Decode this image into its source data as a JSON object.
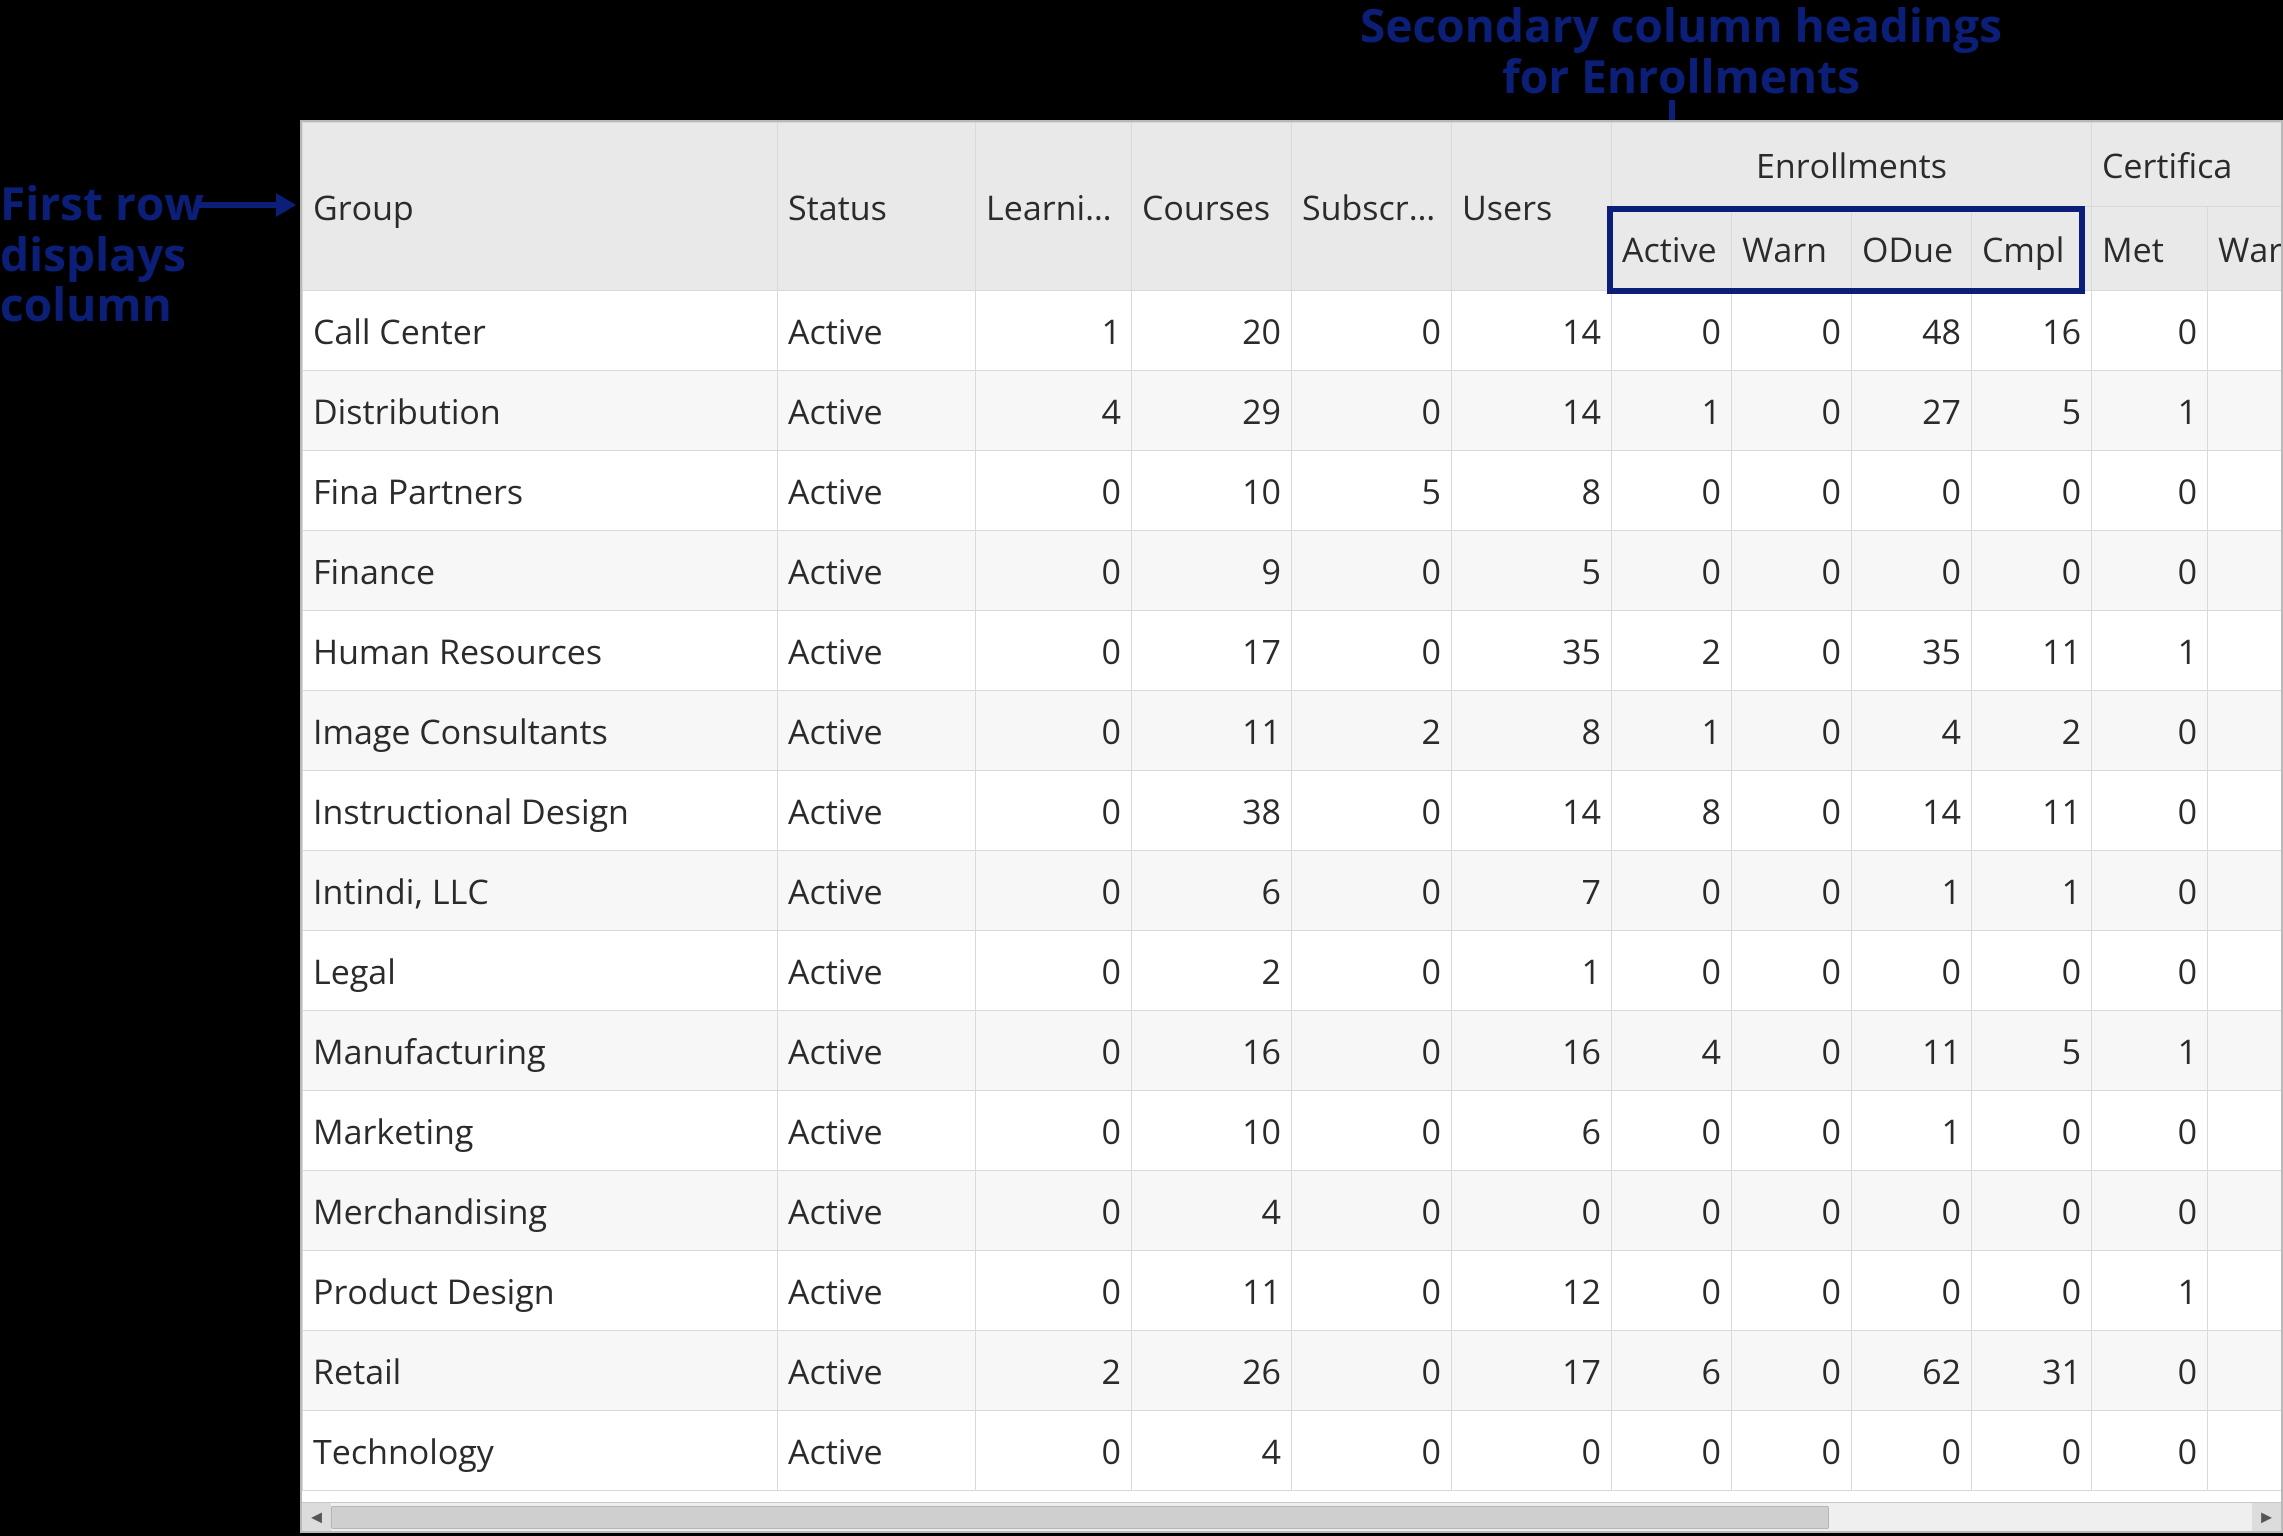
{
  "annotations": {
    "first_row": "First row\ndisplays\ncolumn",
    "secondary": "Secondary column headings\nfor Enrollments"
  },
  "headers": {
    "group": "Group",
    "status": "Status",
    "learning": "Learnin…",
    "courses": "Courses",
    "subscri": "Subscri…",
    "users": "Users",
    "enrollments": "Enrollments",
    "enr_active": "Active",
    "enr_warn": "Warn",
    "enr_odue": "ODue",
    "enr_cmpl": "Cmpl",
    "certifica": "Certifica",
    "cert_met": "Met",
    "cert_warn": "Warn"
  },
  "rows": [
    {
      "group": "Call Center",
      "status": "Active",
      "learning": 1,
      "courses": 20,
      "subs": 0,
      "users": 14,
      "e_active": 0,
      "e_warn": 0,
      "e_odue": 48,
      "e_cmpl": 16,
      "c_met": 0,
      "c_warn": ""
    },
    {
      "group": "Distribution",
      "status": "Active",
      "learning": 4,
      "courses": 29,
      "subs": 0,
      "users": 14,
      "e_active": 1,
      "e_warn": 0,
      "e_odue": 27,
      "e_cmpl": 5,
      "c_met": 1,
      "c_warn": ""
    },
    {
      "group": "Fina Partners",
      "status": "Active",
      "learning": 0,
      "courses": 10,
      "subs": 5,
      "users": 8,
      "e_active": 0,
      "e_warn": 0,
      "e_odue": 0,
      "e_cmpl": 0,
      "c_met": 0,
      "c_warn": ""
    },
    {
      "group": "Finance",
      "status": "Active",
      "learning": 0,
      "courses": 9,
      "subs": 0,
      "users": 5,
      "e_active": 0,
      "e_warn": 0,
      "e_odue": 0,
      "e_cmpl": 0,
      "c_met": 0,
      "c_warn": ""
    },
    {
      "group": "Human Resources",
      "status": "Active",
      "learning": 0,
      "courses": 17,
      "subs": 0,
      "users": 35,
      "e_active": 2,
      "e_warn": 0,
      "e_odue": 35,
      "e_cmpl": 11,
      "c_met": 1,
      "c_warn": ""
    },
    {
      "group": "Image Consultants",
      "status": "Active",
      "learning": 0,
      "courses": 11,
      "subs": 2,
      "users": 8,
      "e_active": 1,
      "e_warn": 0,
      "e_odue": 4,
      "e_cmpl": 2,
      "c_met": 0,
      "c_warn": ""
    },
    {
      "group": "Instructional Design",
      "status": "Active",
      "learning": 0,
      "courses": 38,
      "subs": 0,
      "users": 14,
      "e_active": 8,
      "e_warn": 0,
      "e_odue": 14,
      "e_cmpl": 11,
      "c_met": 0,
      "c_warn": ""
    },
    {
      "group": "Intindi, LLC",
      "status": "Active",
      "learning": 0,
      "courses": 6,
      "subs": 0,
      "users": 7,
      "e_active": 0,
      "e_warn": 0,
      "e_odue": 1,
      "e_cmpl": 1,
      "c_met": 0,
      "c_warn": ""
    },
    {
      "group": "Legal",
      "status": "Active",
      "learning": 0,
      "courses": 2,
      "subs": 0,
      "users": 1,
      "e_active": 0,
      "e_warn": 0,
      "e_odue": 0,
      "e_cmpl": 0,
      "c_met": 0,
      "c_warn": ""
    },
    {
      "group": "Manufacturing",
      "status": "Active",
      "learning": 0,
      "courses": 16,
      "subs": 0,
      "users": 16,
      "e_active": 4,
      "e_warn": 0,
      "e_odue": 11,
      "e_cmpl": 5,
      "c_met": 1,
      "c_warn": ""
    },
    {
      "group": "Marketing",
      "status": "Active",
      "learning": 0,
      "courses": 10,
      "subs": 0,
      "users": 6,
      "e_active": 0,
      "e_warn": 0,
      "e_odue": 1,
      "e_cmpl": 0,
      "c_met": 0,
      "c_warn": ""
    },
    {
      "group": "Merchandising",
      "status": "Active",
      "learning": 0,
      "courses": 4,
      "subs": 0,
      "users": 0,
      "e_active": 0,
      "e_warn": 0,
      "e_odue": 0,
      "e_cmpl": 0,
      "c_met": 0,
      "c_warn": ""
    },
    {
      "group": "Product Design",
      "status": "Active",
      "learning": 0,
      "courses": 11,
      "subs": 0,
      "users": 12,
      "e_active": 0,
      "e_warn": 0,
      "e_odue": 0,
      "e_cmpl": 0,
      "c_met": 1,
      "c_warn": ""
    },
    {
      "group": "Retail",
      "status": "Active",
      "learning": 2,
      "courses": 26,
      "subs": 0,
      "users": 17,
      "e_active": 6,
      "e_warn": 0,
      "e_odue": 62,
      "e_cmpl": 31,
      "c_met": 0,
      "c_warn": ""
    },
    {
      "group": "Technology",
      "status": "Active",
      "learning": 0,
      "courses": 4,
      "subs": 0,
      "users": 0,
      "e_active": 0,
      "e_warn": 0,
      "e_odue": 0,
      "e_cmpl": 0,
      "c_met": 0,
      "c_warn": ""
    }
  ]
}
